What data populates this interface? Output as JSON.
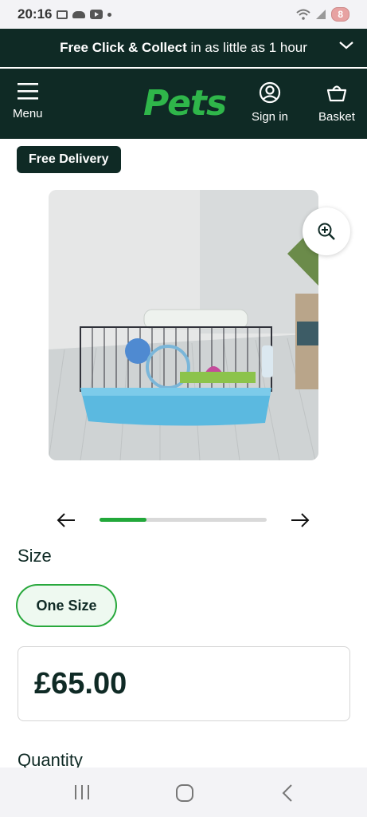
{
  "status_bar": {
    "time": "20:16",
    "battery": "8"
  },
  "promo": {
    "bold": "Free Click & Collect",
    "rest": " in as little as 1 hour"
  },
  "header": {
    "menu_label": "Menu",
    "logo_text": "Pets",
    "signin_label": "Sign in",
    "basket_label": "Basket"
  },
  "product": {
    "badge": "Free Delivery",
    "gallery_progress": 0.28,
    "size_label": "Size",
    "size_option": "One Size",
    "price": "£65.00",
    "quantity_label": "Quantity"
  },
  "colors": {
    "brand_dark": "#0f2a25",
    "brand_green": "#2fb64a"
  }
}
